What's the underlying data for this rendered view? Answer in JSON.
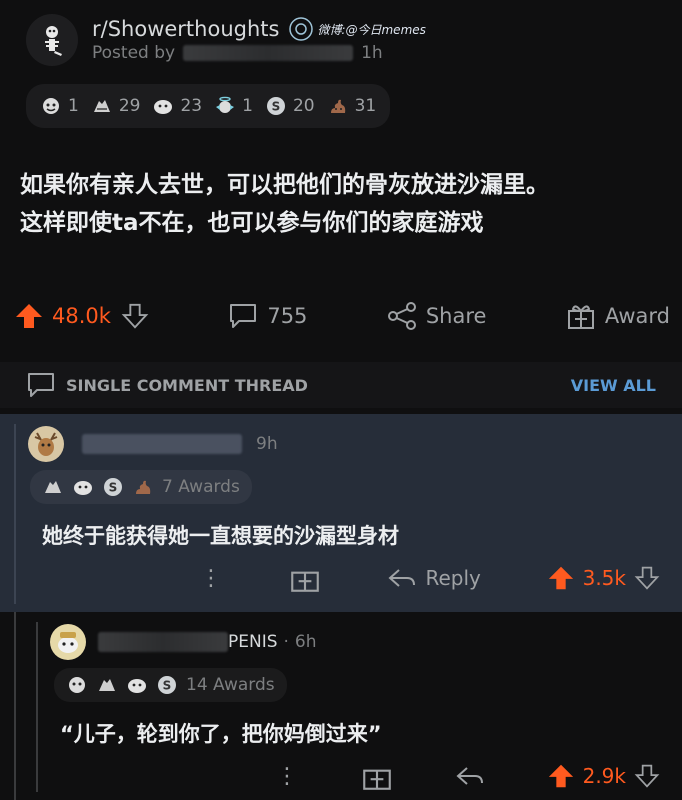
{
  "post": {
    "subreddit": "r/Showerthoughts",
    "posted_by_prefix": "Posted by",
    "age": "1h",
    "watermark": "微博:@今日memes",
    "awards": [
      {
        "icon": "hugz-icon",
        "count": "1"
      },
      {
        "icon": "hands-icon",
        "count": "29"
      },
      {
        "icon": "wholesome-icon",
        "count": "23"
      },
      {
        "icon": "angel-icon",
        "count": "1"
      },
      {
        "icon": "silver-icon",
        "count": "20"
      },
      {
        "icon": "poop-icon",
        "count": "31"
      }
    ],
    "title_line1": "如果你有亲人去世，可以把他们的骨灰放进沙漏里。",
    "title_line2": "这样即使ta不在，也可以参与你们的家庭游戏",
    "upvotes": "48.0k",
    "comments": "755",
    "share_label": "Share",
    "award_label": "Award"
  },
  "thread": {
    "label": "SINGLE COMMENT THREAD",
    "view_all": "VIEW ALL"
  },
  "comment1": {
    "age": "9h",
    "awards_label": "7 Awards",
    "text": "她终于能获得她一直想要的沙漏型身材",
    "reply_label": "Reply",
    "upvotes": "3.5k"
  },
  "comment2": {
    "username_suffix": "PENIS",
    "separator": "·",
    "age": "6h",
    "awards_label": "14 Awards",
    "text": "“儿子，轮到你了，把你妈倒过来”",
    "upvotes": "2.9k"
  },
  "colors": {
    "accent_upvote": "#ff5a1f",
    "link_blue": "#5b9bd5",
    "comment_highlight": "#262d39"
  }
}
